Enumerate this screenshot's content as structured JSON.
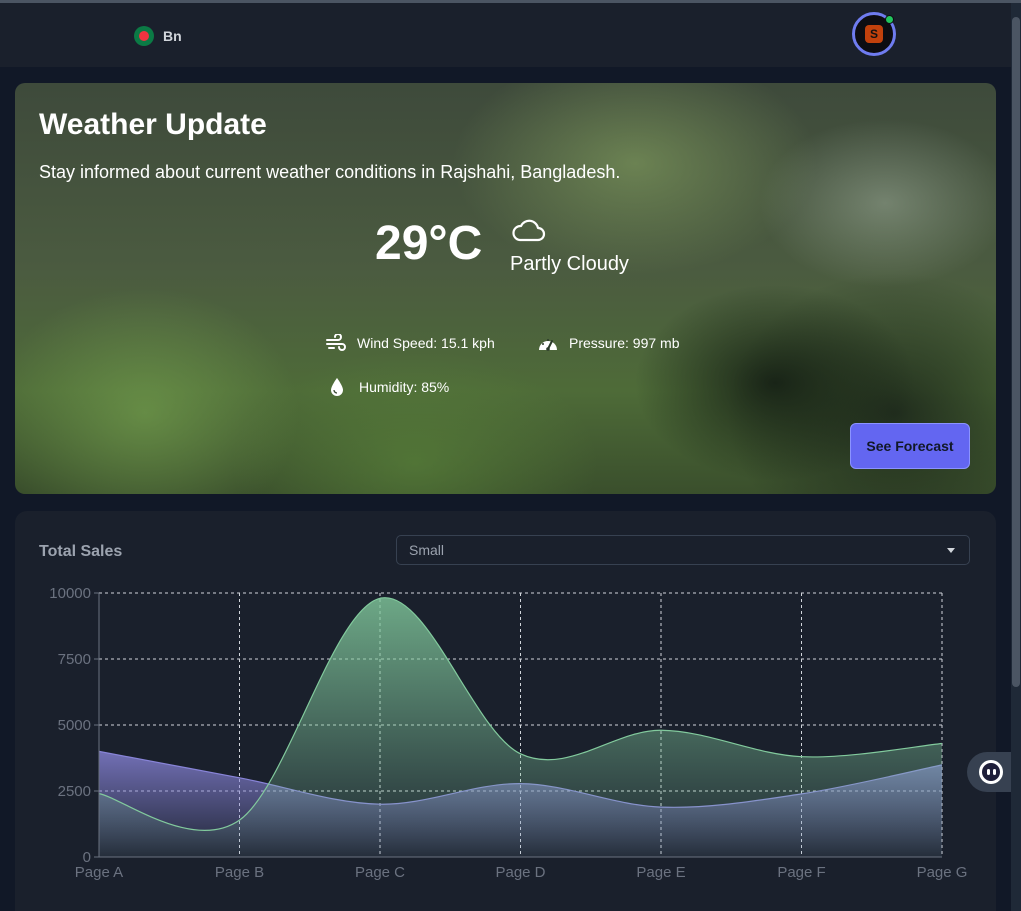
{
  "header": {
    "language_label": "Bn",
    "flag": "bangladesh-flag",
    "avatar_glyph": "S"
  },
  "weather": {
    "title": "Weather Update",
    "subtitle": "Stay informed about current weather conditions in Rajshahi, Bangladesh.",
    "temperature": "29°C",
    "condition": "Partly Cloudy",
    "condition_icon": "cloud-icon",
    "wind": "Wind Speed: 15.1 kph",
    "pressure": "Pressure: 997 mb",
    "humidity": "Humidity: 85%",
    "forecast_button": "See Forecast",
    "accent": "#6366f1"
  },
  "sales": {
    "title": "Total Sales",
    "select_value": "Small"
  },
  "chart_data": {
    "type": "area",
    "categories": [
      "Page A",
      "Page B",
      "Page C",
      "Page D",
      "Page E",
      "Page F",
      "Page G"
    ],
    "series": [
      {
        "values": [
          4000,
          3000,
          2000,
          2780,
          1890,
          2390,
          3490
        ],
        "color": "#8884d8"
      },
      {
        "values": [
          2400,
          1398,
          9800,
          3908,
          4800,
          3800,
          4300
        ],
        "color": "#82ca9d"
      }
    ],
    "yticks": [
      "0",
      "2500",
      "5000",
      "7500",
      "10000"
    ],
    "ylim": [
      0,
      10000
    ],
    "grid": true,
    "curve": "smooth"
  }
}
